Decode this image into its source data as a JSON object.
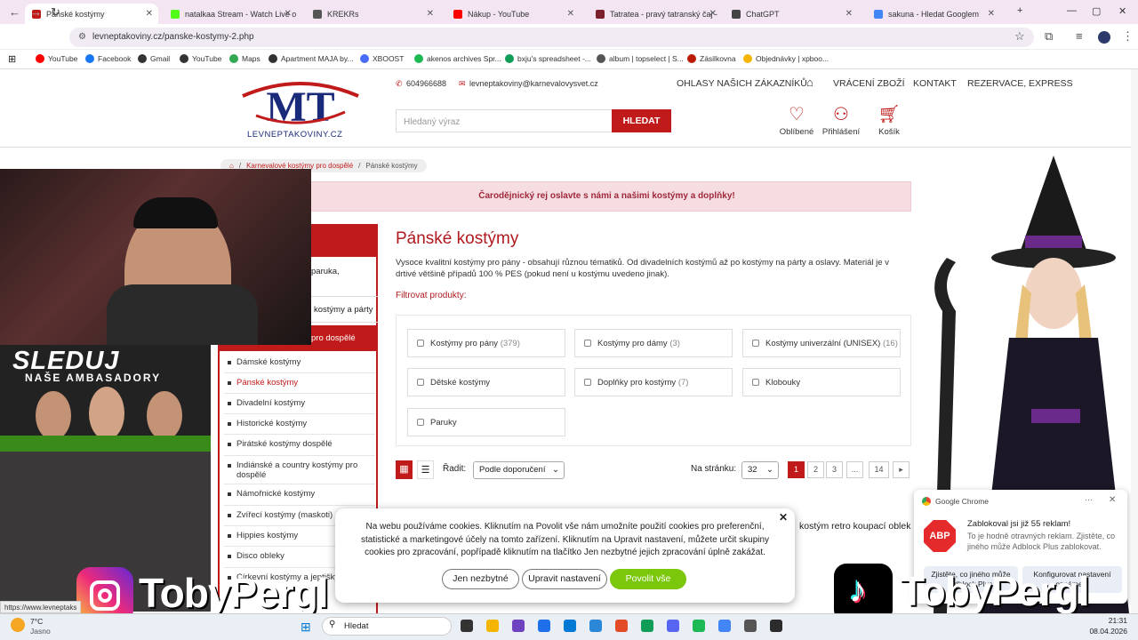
{
  "browser": {
    "tabs": [
      {
        "title": "Pánské kostýmy",
        "color": "#c11a1a"
      },
      {
        "title": "natalkaa Stream - Watch Live o",
        "color": "#53fc18"
      },
      {
        "title": "KREKRs",
        "color": "#555"
      },
      {
        "title": "Nákup - YouTube",
        "color": "#ff0000"
      },
      {
        "title": "Tatratea - pravý tatranský čaj - ",
        "color": "#7a1f2b"
      },
      {
        "title": "ChatGPT",
        "color": "#444"
      },
      {
        "title": "sakuna - Hledat Googlem",
        "color": "#4285f4"
      }
    ],
    "url": "levneptakoviny.cz/panske-kostymy-2.php",
    "bookmarks": [
      {
        "label": "YouTube",
        "color": "#ff0000"
      },
      {
        "label": "Facebook",
        "color": "#1877f2"
      },
      {
        "label": "Gmail",
        "color": "#333"
      },
      {
        "label": "YouTube",
        "color": "#333"
      },
      {
        "label": "Maps",
        "color": "#34a853"
      },
      {
        "label": "Apartment MAJA by...",
        "color": "#333"
      },
      {
        "label": "XBOOST",
        "color": "#4a6cf7"
      },
      {
        "label": "akenos archives Spr...",
        "color": "#1db954"
      },
      {
        "label": "bxju's spreadsheet -...",
        "color": "#0f9d58"
      },
      {
        "label": "album | topselect | S...",
        "color": "#555"
      },
      {
        "label": "Zásilkovna",
        "color": "#ba1b02"
      },
      {
        "label": "Objednávky | xpboo...",
        "color": "#f6b400"
      }
    ]
  },
  "site": {
    "logo_text": "LEVNEPTAKOVINY.CZ",
    "phone": "604966688",
    "email": "levneptakoviny@karnevalovysvet.cz",
    "nav": [
      "OHLASY NAŠICH ZÁKAZNÍKŮ",
      "VRÁCENÍ ZBOŽÍ",
      "KONTAKT",
      "REZERVACE, EXPRESS"
    ],
    "search_placeholder": "Hledaný výraz",
    "search_button": "HLEDAT",
    "header_icons": [
      {
        "label": "Oblíbené",
        "icon": "heart-icon"
      },
      {
        "label": "Přihlášení",
        "icon": "user-icon"
      },
      {
        "label": "Košík",
        "icon": "cart-icon"
      }
    ],
    "breadcrumb": [
      "Karnevalové kostýmy pro dospělé",
      "Pánské kostýmy"
    ],
    "banner": "Čarodějnický rej oslavte s námi a našimi kostýmy a doplňky!",
    "sidebar_partial": [
      "paruka,",
      "kostýmy a párty",
      "pro dospělé"
    ],
    "sidebar": [
      "Dámské kostýmy",
      "Pánské kostýmy",
      "Divadelní kostýmy",
      "Historické kostýmy",
      "Pirátské kostýmy dospělé",
      "Indiánské a country kostýmy pro dospělé",
      "Námořnické kostýmy",
      "Zvířecí kostýmy (maskoti)",
      "Hippies kostýmy",
      "Disco obleky",
      "Církevní kostýmy a jeptišky"
    ],
    "title": "Pánské kostýmy",
    "description": "Vysoce kvalitní kostýmy pro pány - obsahují různou tématiků. Od divadelních kostýmů až po kostýmy na párty a oslavy. Materiál je v drtivé většině případů 100 % PES (pokud není u kostýmu uvedeno jinak).",
    "filter_label": "Filtrovat produkty:",
    "filters": [
      {
        "label": "Kostýmy pro pány",
        "count": "(379)"
      },
      {
        "label": "Kostýmy pro dámy",
        "count": "(3)"
      },
      {
        "label": "Kostýmy univerzální (UNISEX)",
        "count": "(16)"
      },
      {
        "label": "Dětské kostýmy",
        "count": ""
      },
      {
        "label": "Doplňky pro kostýmy",
        "count": "(7)"
      },
      {
        "label": "Klobouky",
        "count": ""
      },
      {
        "label": "Paruky",
        "count": ""
      }
    ],
    "sort_label": "Řadit:",
    "sort_value": "Podle doporučení",
    "per_page_label": "Na stránku:",
    "per_page_value": "32",
    "pages": [
      "1",
      "2",
      "3",
      "...",
      "14"
    ],
    "product_partial": "kostým retro koupací oblek"
  },
  "cookie": {
    "text": "Na webu používáme cookies. Kliknutím na Povolit vše nám umožníte použití cookies pro preferenční, statistické a marketingové účely na tomto zařízení. Kliknutím na Upravit nastavení, můžete určit skupiny cookies pro zpracování, popřípadě kliknutím na tlačítko Jen nezbytné jejich zpracování úplně zakážat.",
    "btn_necessary": "Jen nezbytné",
    "btn_settings": "Upravit nastavení",
    "btn_allow": "Povolit vše",
    "allow_color": "#7ac70c"
  },
  "notification": {
    "app": "Google Chrome",
    "title": "Zablokoval jsi již 55 reklam!",
    "body": "To je hodně otravných reklam. Zjistěte, co jiného může Adblock Plus zablokovat.",
    "btn1": "Zjistěte, co jiného může Adblock Plus",
    "btn2": "Konfigurovat nastavení oznámení",
    "abp": "ABP"
  },
  "stream": {
    "sleduj": "SLEDUJ",
    "ambasadory": "NAŠE AMBASADORY",
    "handle_left": "TobyPergl",
    "handle_right": "TobyPergl"
  },
  "statusbar": "https://www.levneptaks",
  "taskbar": {
    "weather_temp": "7°C",
    "weather_desc": "Jasno",
    "search": "Hledat",
    "time": "21:31",
    "date": "08.04.2026"
  }
}
